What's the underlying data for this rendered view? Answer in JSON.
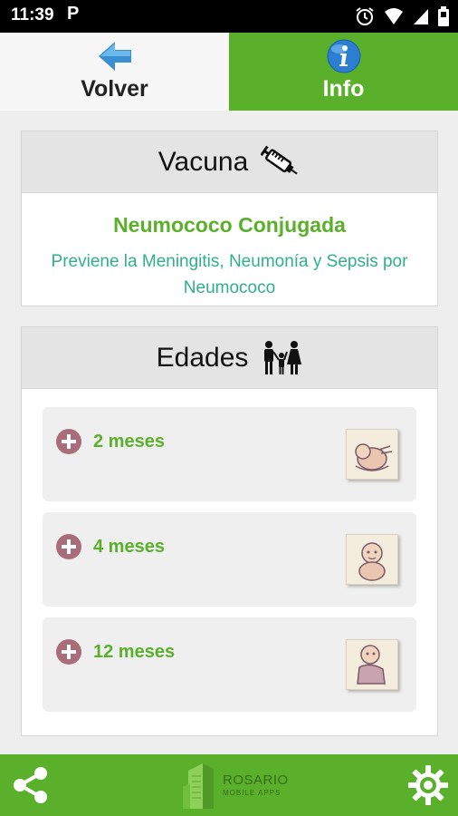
{
  "status_bar": {
    "time": "11:39",
    "app_badge": "P"
  },
  "tabs": [
    {
      "label": "Volver",
      "icon": "back-arrow-icon"
    },
    {
      "label": "Info",
      "icon": "info-icon"
    }
  ],
  "vacuna": {
    "header": "Vacuna",
    "icon": "syringe-icon",
    "name": "Neumococo Conjugada",
    "description": "Previene la Meningitis, Neumonía y Sepsis por Neumococo"
  },
  "edades": {
    "header": "Edades",
    "icon": "family-icon",
    "items": [
      {
        "label": "2 meses"
      },
      {
        "label": "4 meses"
      },
      {
        "label": "12 meses"
      }
    ]
  },
  "bottom_bar": {
    "logo_line1": "ROSARIO",
    "logo_line2": "MOBILE APPS"
  },
  "colors": {
    "green": "#5ab02a",
    "teal": "#2fb08a",
    "plus": "#a86c7a"
  }
}
